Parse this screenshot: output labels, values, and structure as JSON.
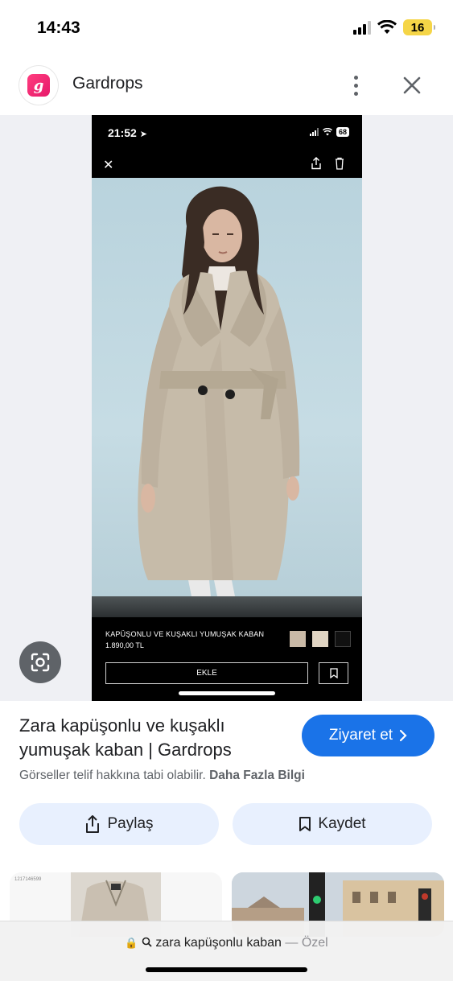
{
  "status_bar": {
    "time": "14:43",
    "battery": "16"
  },
  "header": {
    "site_name": "Gardrops",
    "logo_letter": "g"
  },
  "screenshot": {
    "time": "21:52",
    "battery": "68",
    "product_name": "KAPÜŞONLU VE KUŞAKLI YUMUŞAK KABAN",
    "price": "1.890,00 TL",
    "add_label": "EKLE",
    "swatch_colors": [
      "#c9b9a6",
      "#e0d4c2",
      "#111111"
    ]
  },
  "result": {
    "title": "Zara kapüşonlu ve kuşaklı yumuşak kaban | Gardrops",
    "visit_label": "Ziyaret et",
    "copyright_text": "Görseller telif hakkına tabi olabilir.",
    "more_info_label": "Daha Fazla Bilgi"
  },
  "actions": {
    "share_label": "Paylaş",
    "save_label": "Kaydet"
  },
  "related": {
    "left_code": "1217146599"
  },
  "url_bar": {
    "query": "zara kapüşonlu kaban",
    "separator": "—",
    "mode": "Özel"
  },
  "colors": {
    "accent": "#1a73e8",
    "chip_bg": "#e8f0fe",
    "logo": "#e6196a"
  }
}
